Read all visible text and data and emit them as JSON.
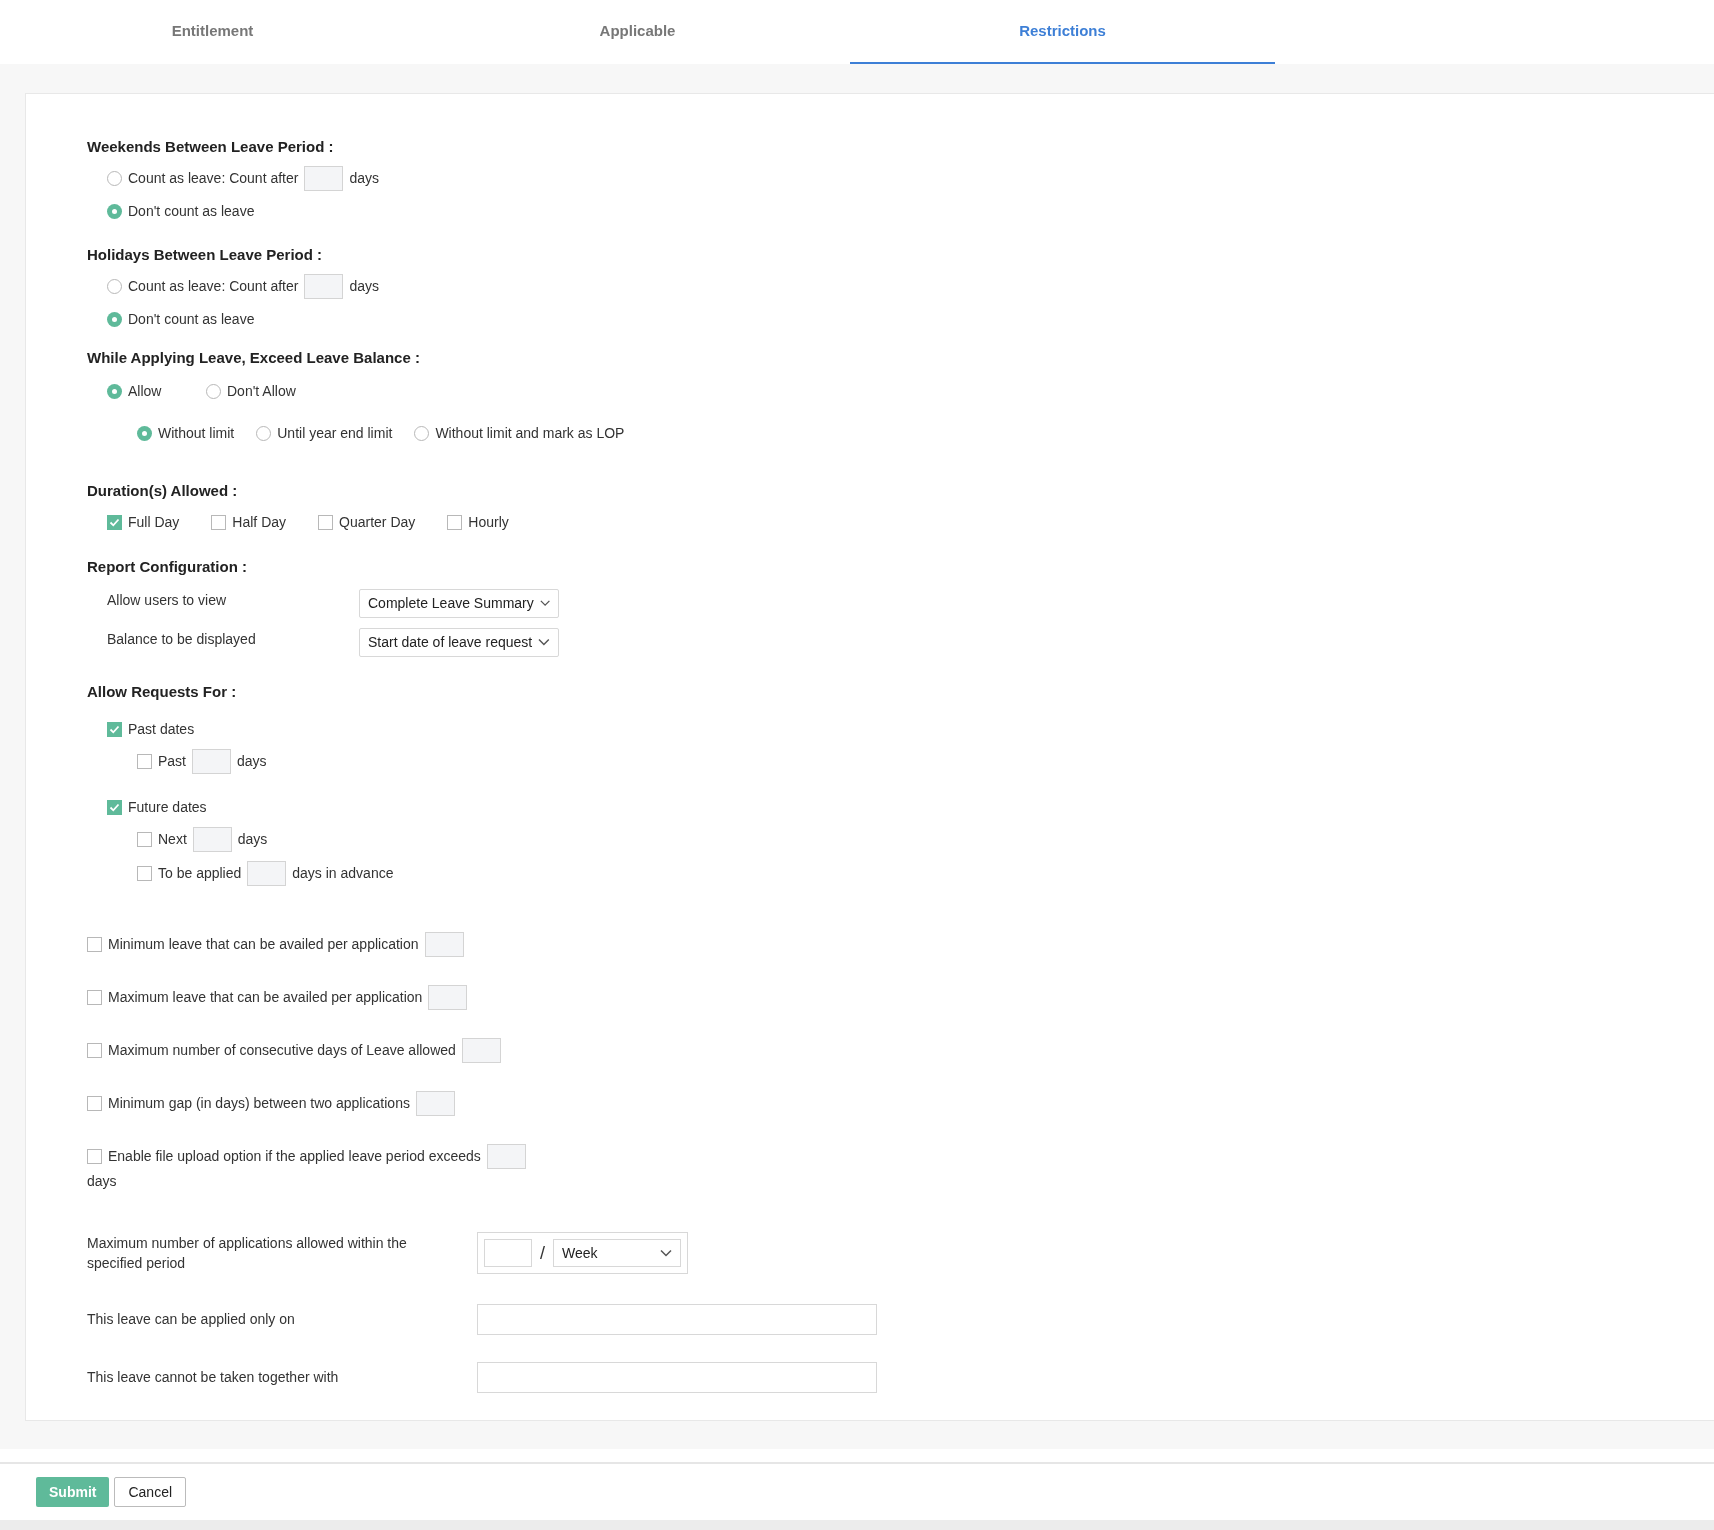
{
  "tabs": [
    {
      "label": "Entitlement",
      "selected": false
    },
    {
      "label": "Applicable",
      "selected": false
    },
    {
      "label": "Restrictions",
      "selected": true
    }
  ],
  "weekends": {
    "title": "Weekends Between Leave Period :",
    "options": [
      {
        "kind": "count",
        "label": "Count as leave: Count after",
        "suffix": "days",
        "selected": false
      },
      {
        "kind": "plain",
        "label": "Don't count as leave",
        "selected": true
      }
    ]
  },
  "holidays": {
    "title": "Holidays Between Leave Period :",
    "options": [
      {
        "kind": "count",
        "label": "Count as leave: Count after",
        "suffix": "days",
        "selected": false
      },
      {
        "kind": "plain",
        "label": "Don't count as leave",
        "selected": true
      }
    ]
  },
  "exceed": {
    "title": "While Applying Leave, Exceed Leave Balance :",
    "options": [
      {
        "label": "Allow",
        "selected": true
      },
      {
        "label": "Don't Allow",
        "selected": false
      }
    ],
    "sub_options": [
      {
        "label": "Without limit",
        "selected": true
      },
      {
        "label": "Until year end limit",
        "selected": false
      },
      {
        "label": "Without limit and mark as LOP",
        "selected": false
      }
    ]
  },
  "durations": {
    "title": "Duration(s) Allowed :",
    "options": [
      {
        "label": "Full Day",
        "checked": true
      },
      {
        "label": "Half Day",
        "checked": false
      },
      {
        "label": "Quarter Day",
        "checked": false
      },
      {
        "label": "Hourly",
        "checked": false
      }
    ]
  },
  "report": {
    "title": "Report Configuration :",
    "rows": [
      {
        "label": "Allow users to view",
        "value": "Complete Leave Summary"
      },
      {
        "label": "Balance to be displayed",
        "value": "Start date of leave request"
      }
    ]
  },
  "requests": {
    "title": "Allow Requests For :",
    "groups": [
      {
        "label": "Past dates",
        "checked": true,
        "options": [
          {
            "prefix": "Past",
            "suffix": "days",
            "checked": false
          }
        ]
      },
      {
        "label": "Future dates",
        "checked": true,
        "options": [
          {
            "prefix": "Next",
            "suffix": "days",
            "checked": false
          },
          {
            "prefix": "To be applied",
            "suffix": "days in advance",
            "checked": false
          }
        ]
      }
    ]
  },
  "limits": [
    {
      "label": "Minimum leave that can be availed per application",
      "checked": false
    },
    {
      "label": "Maximum leave that can be availed per application",
      "checked": false
    },
    {
      "label": "Maximum number of consecutive days of Leave allowed",
      "checked": false
    },
    {
      "label": "Minimum gap (in days) between two applications",
      "checked": false
    },
    {
      "label": "Enable file upload option if the applied leave period exceeds",
      "checked": false,
      "suffix": "days"
    }
  ],
  "period": {
    "label": "Maximum number of applications allowed within the specified period",
    "separator": "/",
    "unit": "Week"
  },
  "fields": [
    {
      "label": "This leave can be applied only on"
    },
    {
      "label": "This leave cannot be taken together with"
    }
  ],
  "buttons": [
    {
      "kind": "primary",
      "label": "Submit"
    },
    {
      "kind": "secondary",
      "label": "Cancel"
    }
  ]
}
